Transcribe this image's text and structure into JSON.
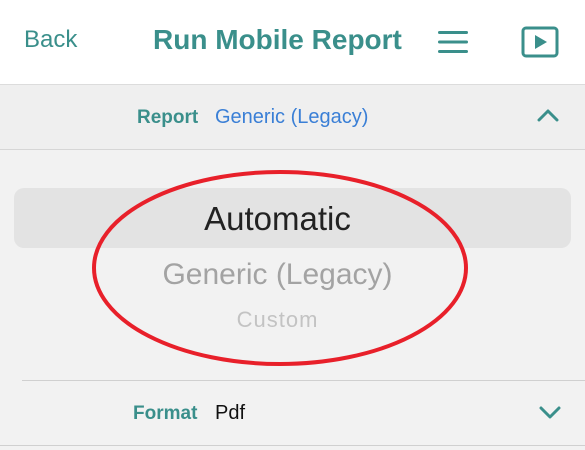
{
  "header": {
    "back_label": "Back",
    "title": "Run Mobile Report",
    "menu_icon": "hamburger-menu-icon",
    "run_icon": "play-icon"
  },
  "report": {
    "label": "Report",
    "value": "Generic (Legacy)",
    "toggle_icon": "chevron-up-icon"
  },
  "picker": {
    "options": [
      "Automatic",
      "Generic (Legacy)",
      "Custom"
    ],
    "selected": "Automatic"
  },
  "format": {
    "label": "Format",
    "value": "Pdf",
    "toggle_icon": "chevron-down-icon"
  },
  "colors": {
    "accent": "#3a8f8b",
    "link": "#3a7fd6",
    "annotation": "#e8202a"
  }
}
